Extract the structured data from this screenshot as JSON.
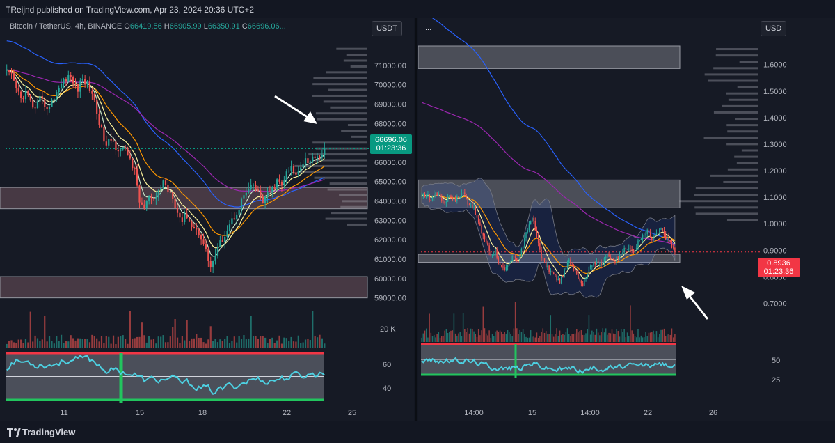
{
  "header": {
    "published_line": "TReijnd published on TradingView.com, Apr 23, 2024 20:36 UTC+2"
  },
  "footer": {
    "brand": "TradingView"
  },
  "left_panel": {
    "legend": {
      "symbol": "Bitcoin / TetherUS, 4h, BINANCE",
      "o_label": "O",
      "o_value": "66419.56",
      "h_label": "H",
      "h_value": "66905.99",
      "l_label": "L",
      "l_value": "66350.91",
      "c_label": "C",
      "c_value": "66696.06..."
    },
    "currency": "USDT",
    "last_price": "66696.06",
    "countdown": "01:23:36",
    "accent": "#089981"
  },
  "right_panel": {
    "legend": "...",
    "currency": "USD",
    "last_price": "0.8936",
    "countdown": "01:23:36",
    "accent": "#f23645"
  },
  "chart_data": [
    {
      "type": "candlestick",
      "title": "Bitcoin / TetherUS, 4h, BINANCE",
      "ylim": [
        58700,
        72000
      ],
      "y_ticks": [
        "71000.00",
        "70000.00",
        "69000.00",
        "68000.00",
        "67000.00",
        "66000.00",
        "65000.00",
        "64000.00",
        "63000.00",
        "62000.00",
        "61000.00",
        "60000.00",
        "59000.00"
      ],
      "x_ticks": [
        "11",
        "15",
        "18",
        "22",
        "25"
      ],
      "volume_tick": "20 K",
      "oscillator_ticks": [
        "60",
        "40"
      ],
      "close_path": [
        70600,
        70400,
        69800,
        69300,
        69600,
        69100,
        68700,
        69200,
        69000,
        68800,
        69400,
        69900,
        70200,
        70500,
        70100,
        69800,
        70300,
        70000,
        69600,
        68600,
        67600,
        66800,
        67200,
        66800,
        66700,
        66600,
        66200,
        65500,
        64000,
        63600,
        64200,
        63900,
        64500,
        65000,
        64600,
        64300,
        63400,
        63000,
        63300,
        62700,
        62500,
        62200,
        61400,
        60600,
        61200,
        61800,
        62300,
        62800,
        63200,
        63700,
        64300,
        64500,
        64800,
        64400,
        64000,
        64300,
        64600,
        65000,
        64800,
        65400,
        65700,
        65300,
        65900,
        66200,
        66000,
        66400,
        66300,
        66700
      ],
      "zones": [
        {
          "from": 63600,
          "to": 64700
        },
        {
          "from": 59000,
          "to": 60100
        }
      ],
      "lines": [
        {
          "name": "",
          "color": "#2962ff"
        },
        {
          "name": "",
          "color": "#9c27b0"
        },
        {
          "name": "",
          "color": "#ff9800"
        },
        {
          "name": "",
          "color": "#fff59d"
        },
        {
          "name": "",
          "color": "#c8e6c9"
        }
      ]
    },
    {
      "type": "candlestick",
      "title": "",
      "ylim": [
        0.62,
        1.67
      ],
      "y_ticks": [
        "1.6000",
        "1.5000",
        "1.4000",
        "1.3000",
        "1.2000",
        "1.1000",
        "1.0000",
        "0.9000",
        "0.8000",
        "0.7000"
      ],
      "x_ticks": [
        "14:00",
        "15",
        "14:00",
        "22",
        "26"
      ],
      "oscillator_ticks": [
        "50",
        "25"
      ],
      "close_path": [
        1.1,
        1.11,
        1.09,
        1.12,
        1.1,
        1.08,
        1.11,
        1.09,
        1.1,
        1.12,
        1.08,
        1.07,
        1.02,
        0.97,
        0.93,
        0.88,
        0.9,
        0.84,
        0.82,
        0.85,
        0.88,
        0.86,
        0.92,
        0.98,
        1.03,
        0.95,
        0.88,
        0.84,
        0.82,
        0.8,
        0.78,
        0.82,
        0.86,
        0.84,
        0.8,
        0.77,
        0.82,
        0.85,
        0.86,
        0.84,
        0.88,
        0.87,
        0.86,
        0.89,
        0.9,
        0.91,
        0.89,
        0.93,
        0.95,
        0.97,
        0.94,
        0.96,
        0.98,
        0.95,
        0.93,
        0.8936
      ],
      "zones": [
        {
          "from": 1.06,
          "to": 1.165
        },
        {
          "from": 0.855,
          "to": 0.885
        },
        {
          "from": 1.585,
          "to": 1.67
        }
      ],
      "lines": [
        {
          "name": "",
          "color": "#2962ff"
        },
        {
          "name": "",
          "color": "#9c27b0"
        },
        {
          "name": "",
          "color": "#ff9800"
        },
        {
          "name": "",
          "color": "#fff59d"
        }
      ]
    }
  ]
}
